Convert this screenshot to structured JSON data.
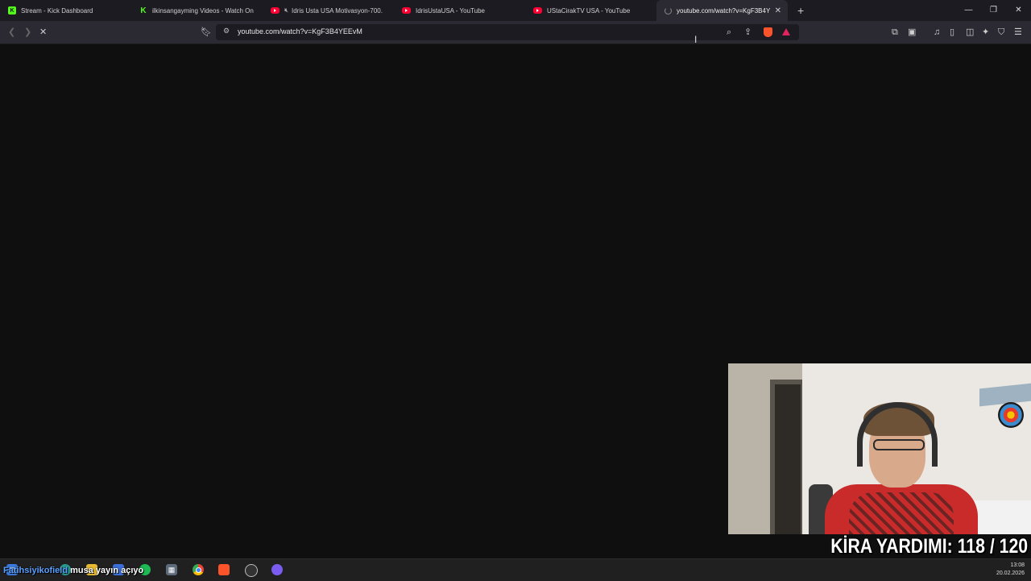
{
  "tabs": [
    {
      "title": "Stream - Kick Dashboard",
      "favicon": "kick-icon",
      "muted": false,
      "active": false
    },
    {
      "title": "ilkinsangayming Videos - Watch On",
      "favicon": "kick-outline-icon",
      "muted": false,
      "active": false
    },
    {
      "title": "Idris Usta USA Motivasyon-700.",
      "favicon": "youtube-icon",
      "muted": true,
      "active": false
    },
    {
      "title": "IdrisUstaUSA - YouTube",
      "favicon": "youtube-icon",
      "muted": false,
      "active": false
    },
    {
      "title": "UStaCirakTV USA - YouTube",
      "favicon": "youtube-icon",
      "muted": false,
      "active": false
    },
    {
      "title": "youtube.com/watch?v=KgF3B4Y",
      "favicon": "loading-spinner-icon",
      "muted": false,
      "active": true
    }
  ],
  "address_bar": {
    "url": "youtube.com/watch?v=KgF3B4YEEvM"
  },
  "overlay": {
    "follower_name": "Fatihsiyikofield",
    "follower_message": "musa yayın açıyo",
    "kira_text": "KİRA YARDIMI: 118 / 120"
  },
  "taskbar": {
    "time": "13:08",
    "date": "20.02.2026"
  },
  "colors": {
    "kick_green": "#53fc18",
    "youtube_red": "#ff0033",
    "brave_orange": "#fb542b",
    "page_background": "#0f0f0f"
  }
}
